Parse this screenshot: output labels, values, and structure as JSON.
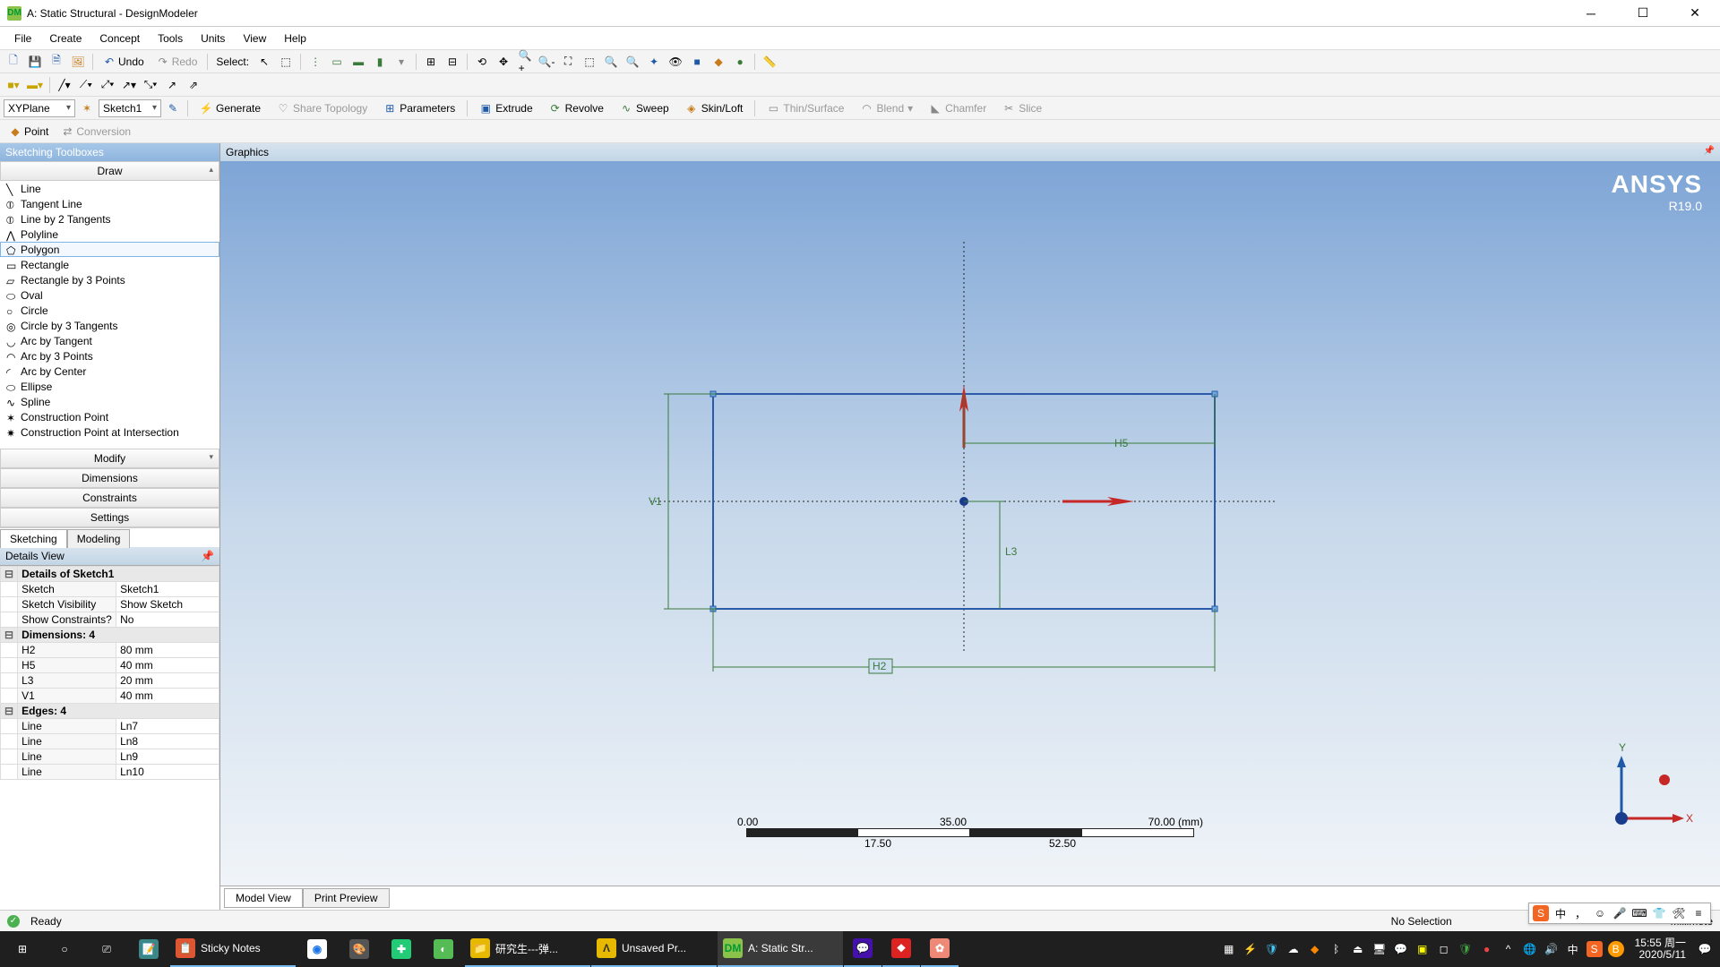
{
  "window": {
    "title": "A: Static Structural - DesignModeler"
  },
  "menu": {
    "items": [
      "File",
      "Create",
      "Concept",
      "Tools",
      "Units",
      "View",
      "Help"
    ]
  },
  "toolbar1": {
    "undo": "Undo",
    "redo": "Redo",
    "select_label": "Select:"
  },
  "plane_bar": {
    "plane": "XYPlane",
    "sketch": "Sketch1",
    "point": "Point",
    "conversion": "Conversion"
  },
  "modeling": {
    "generate": "Generate",
    "share_topology": "Share Topology",
    "parameters": "Parameters",
    "extrude": "Extrude",
    "revolve": "Revolve",
    "sweep": "Sweep",
    "skin_loft": "Skin/Loft",
    "thin_surface": "Thin/Surface",
    "blend": "Blend",
    "chamfer": "Chamfer",
    "slice": "Slice"
  },
  "sketching_panel": {
    "title": "Sketching Toolboxes",
    "draw_category": "Draw",
    "draw_tools": [
      "Line",
      "Tangent Line",
      "Line by 2 Tangents",
      "Polyline",
      "Polygon",
      "Rectangle",
      "Rectangle by 3 Points",
      "Oval",
      "Circle",
      "Circle by 3 Tangents",
      "Arc by Tangent",
      "Arc by 3 Points",
      "Arc by Center",
      "Ellipse",
      "Spline",
      "Construction Point",
      "Construction Point at Intersection"
    ],
    "other_categories": [
      "Modify",
      "Dimensions",
      "Constraints",
      "Settings"
    ],
    "tabs": {
      "sketching": "Sketching",
      "modeling": "Modeling"
    }
  },
  "details": {
    "title": "Details View",
    "header": "Details of Sketch1",
    "rows1": [
      {
        "label": "Sketch",
        "value": "Sketch1"
      },
      {
        "label": "Sketch Visibility",
        "value": "Show Sketch"
      },
      {
        "label": "Show Constraints?",
        "value": "No"
      }
    ],
    "dims_header": "Dimensions: 4",
    "dims": [
      {
        "label": "H2",
        "value": "80 mm"
      },
      {
        "label": "H5",
        "value": "40 mm"
      },
      {
        "label": "L3",
        "value": "20 mm"
      },
      {
        "label": "V1",
        "value": "40 mm"
      }
    ],
    "edges_header": "Edges: 4",
    "edges": [
      {
        "label": "Line",
        "value": "Ln7"
      },
      {
        "label": "Line",
        "value": "Ln8"
      },
      {
        "label": "Line",
        "value": "Ln9"
      },
      {
        "label": "Line",
        "value": "Ln10"
      }
    ]
  },
  "graphics": {
    "title": "Graphics",
    "brand": "ANSYS",
    "version": "R19.0",
    "dims_labels": {
      "v1": "V1",
      "h2": "H2",
      "l3": "L3",
      "h5": "H5"
    },
    "scale": {
      "t0": "0.00",
      "t1": "17.50",
      "t2": "35.00",
      "t3": "52.50",
      "t4": "70.00",
      "unit": "(mm)"
    },
    "tabs": {
      "model": "Model View",
      "print": "Print Preview"
    },
    "triad": {
      "x": "X",
      "y": "Y"
    }
  },
  "status": {
    "ready": "Ready",
    "selection": "No Selection",
    "units": "Millimete"
  },
  "ime": {
    "lang": "中",
    "punct": "，"
  },
  "taskbar": {
    "apps": [
      {
        "label": "Sticky Notes",
        "color": "#d53"
      },
      {
        "label": "研究生---弹...",
        "color": "#e6b800"
      },
      {
        "label": "Unsaved Pr...",
        "color": "#e6b800"
      },
      {
        "label": "A: Static Str...",
        "color": "#8bc34a"
      }
    ],
    "clock": {
      "time": "15:55",
      "day": "周一",
      "date": "2020/5/11"
    }
  }
}
